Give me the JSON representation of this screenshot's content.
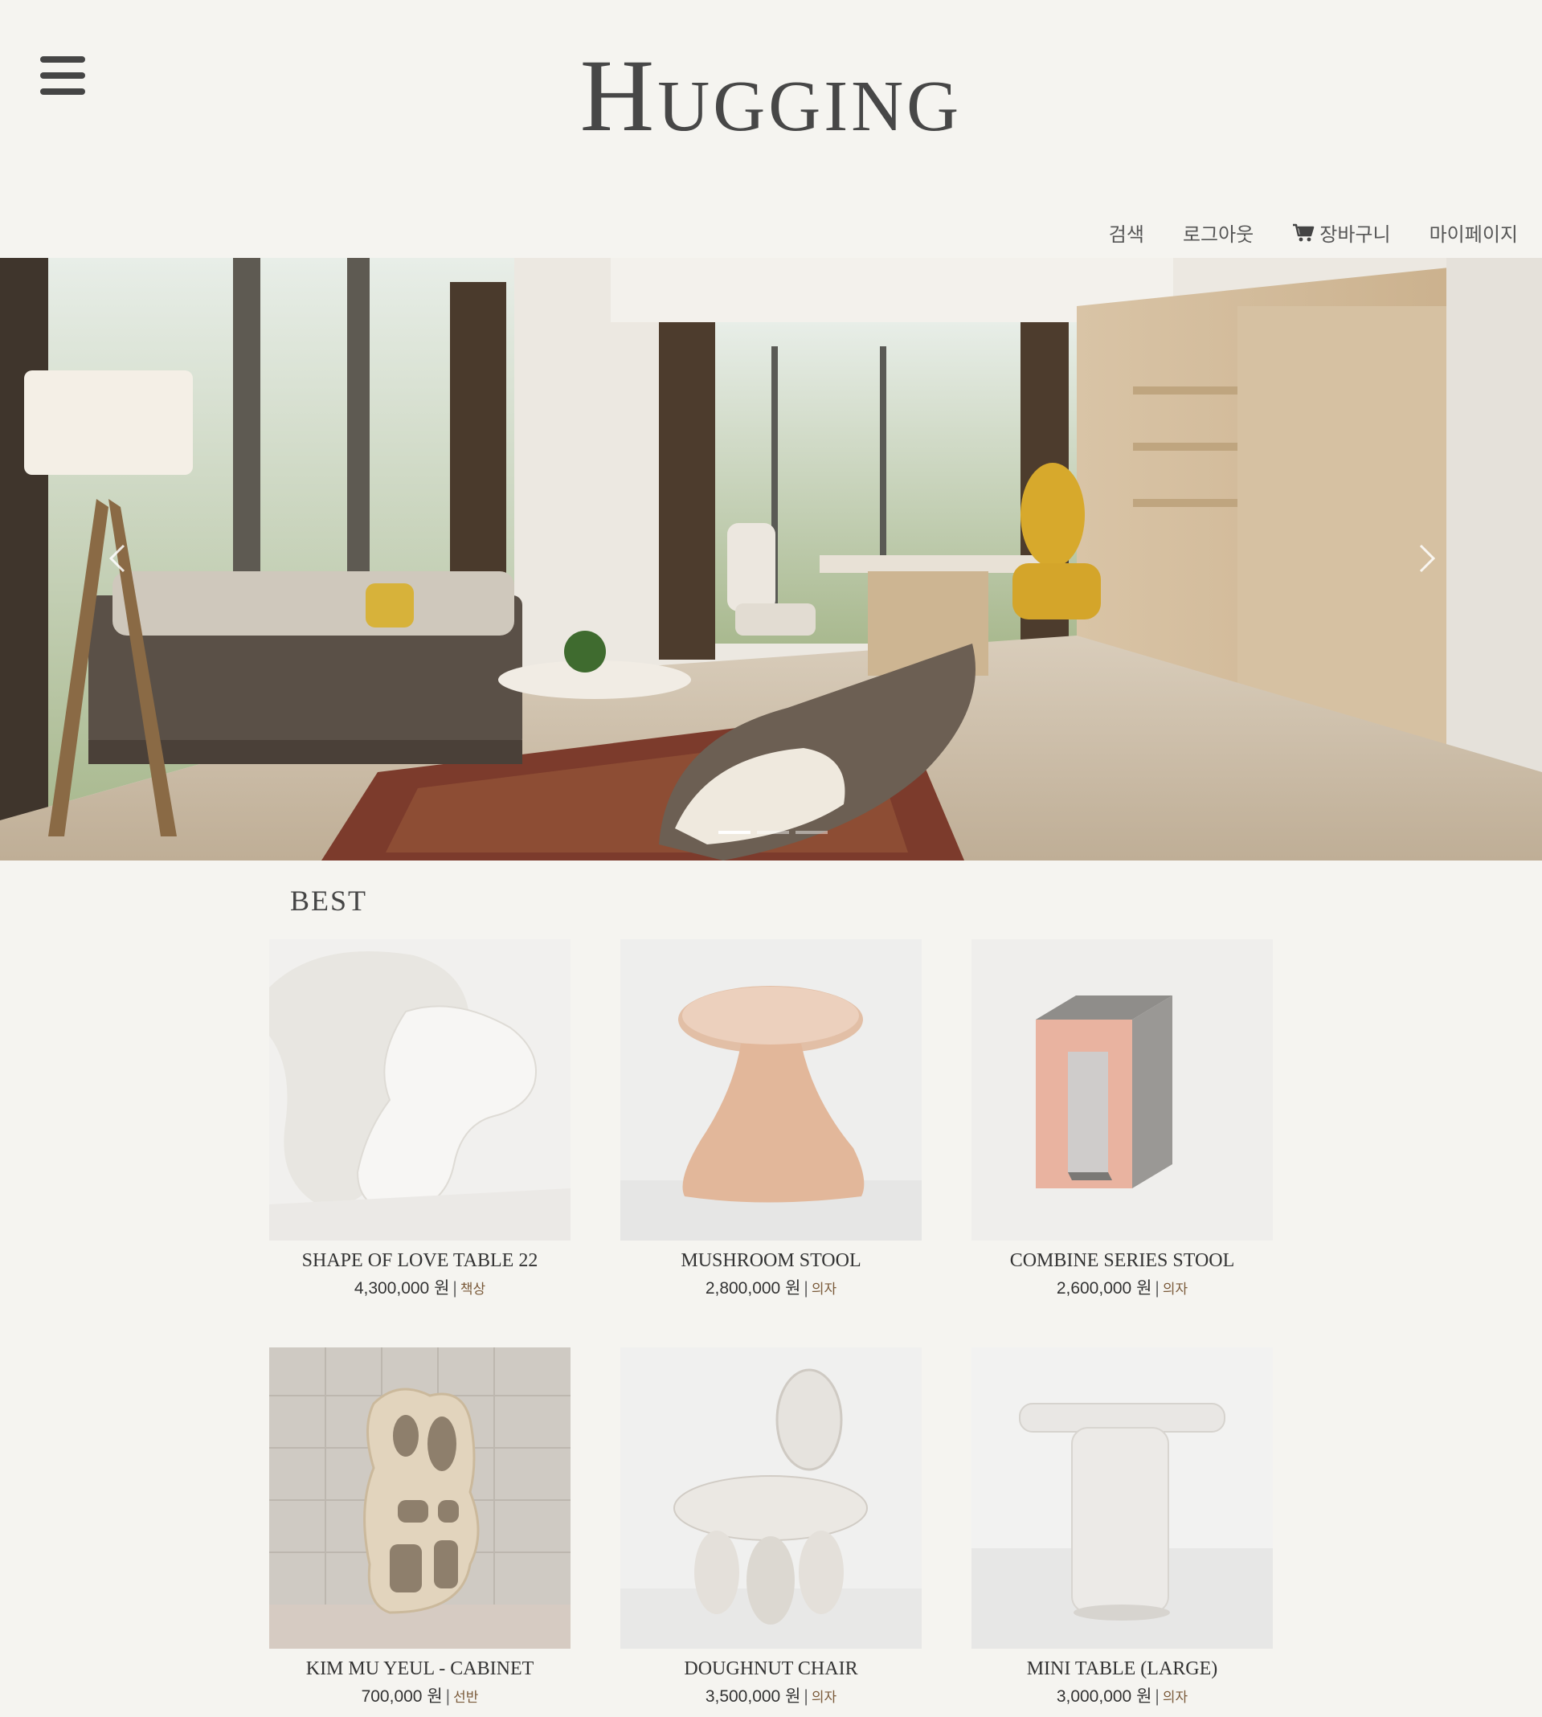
{
  "brand": {
    "logo": "Hugging"
  },
  "nav": {
    "items": [
      {
        "label": "검색",
        "icon": ""
      },
      {
        "label": "로그아웃",
        "icon": ""
      },
      {
        "label": "장바구니",
        "icon": "cart-icon"
      },
      {
        "label": "마이페이지",
        "icon": ""
      }
    ]
  },
  "hero": {
    "slide_count": 3,
    "active_slide": 1
  },
  "best": {
    "title": "BEST",
    "currency_suffix": "원",
    "products": [
      {
        "name": "SHAPE OF LOVE TABLE 22",
        "price": "4,300,000",
        "category": "책상"
      },
      {
        "name": "MUSHROOM STOOL",
        "price": "2,800,000",
        "category": "의자"
      },
      {
        "name": "COMBINE SERIES STOOL",
        "price": "2,600,000",
        "category": "의자"
      },
      {
        "name": "KIM MU YEUL - CABINET",
        "price": "700,000",
        "category": "선반"
      },
      {
        "name": "DOUGHNUT CHAIR",
        "price": "3,500,000",
        "category": "의자"
      },
      {
        "name": "MINI TABLE (LARGE)",
        "price": "3,000,000",
        "category": "의자"
      }
    ]
  },
  "colors": {
    "background": "#f5f4f0",
    "text": "#454545",
    "category": "#7a5a3a"
  }
}
